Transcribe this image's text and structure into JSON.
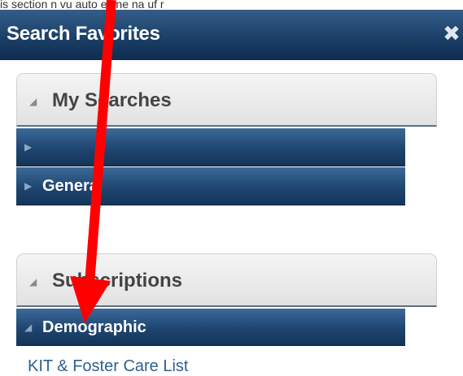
{
  "top_cut_text": "is section  n vu  auto   ec  ne   na   uf    r    ",
  "panel": {
    "title": "Search Favorites",
    "close_glyph": "✖"
  },
  "my_searches": {
    "label": "My Searches",
    "expanded": true,
    "groups": [
      {
        "label": ""
      },
      {
        "label": "General"
      }
    ]
  },
  "subscriptions": {
    "label": "Subscriptions",
    "expanded": true,
    "groups": [
      {
        "label": "Demographic",
        "expanded": true,
        "items": [
          "KIT & Foster Care List"
        ]
      }
    ]
  },
  "colors": {
    "header_blue": "#1c4068",
    "link_blue": "#2f5f8f",
    "annotation_red": "#ff0000"
  },
  "icons": {
    "collapse": "triangle-down-icon",
    "expand": "triangle-right-icon",
    "close": "close-icon"
  }
}
